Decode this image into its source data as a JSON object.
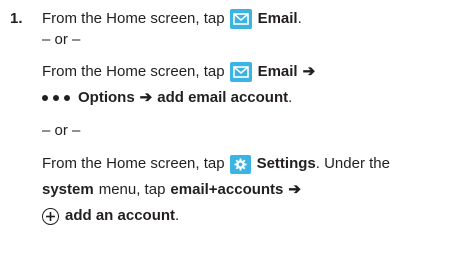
{
  "step_number": "1.",
  "lines": [
    {
      "pre": "From the Home screen, tap",
      "label": "Email",
      "post": "."
    },
    {
      "text": "– or –"
    },
    {
      "pre": "From the Home screen, tap",
      "label": "Email",
      "arrow": "➔"
    },
    {
      "label": "Options",
      "arrow": "➔",
      "tail": "add email account",
      "post": "."
    },
    {
      "text": "– or –"
    },
    {
      "pre": "From the Home screen, tap",
      "label": "Settings",
      "post": ". Under the"
    },
    {
      "bold1": "system",
      "mid": "menu, tap",
      "bold2": "email+accounts",
      "arrow": "➔"
    },
    {
      "label": "add an account",
      "post": "."
    }
  ],
  "icons": {
    "email": "email-envelope-icon",
    "options": "more-options-dots-icon",
    "settings": "settings-gear-icon",
    "add": "plus-circle-icon"
  },
  "colors": {
    "icon_bg": "#3bb3e4",
    "text": "#231f20"
  }
}
